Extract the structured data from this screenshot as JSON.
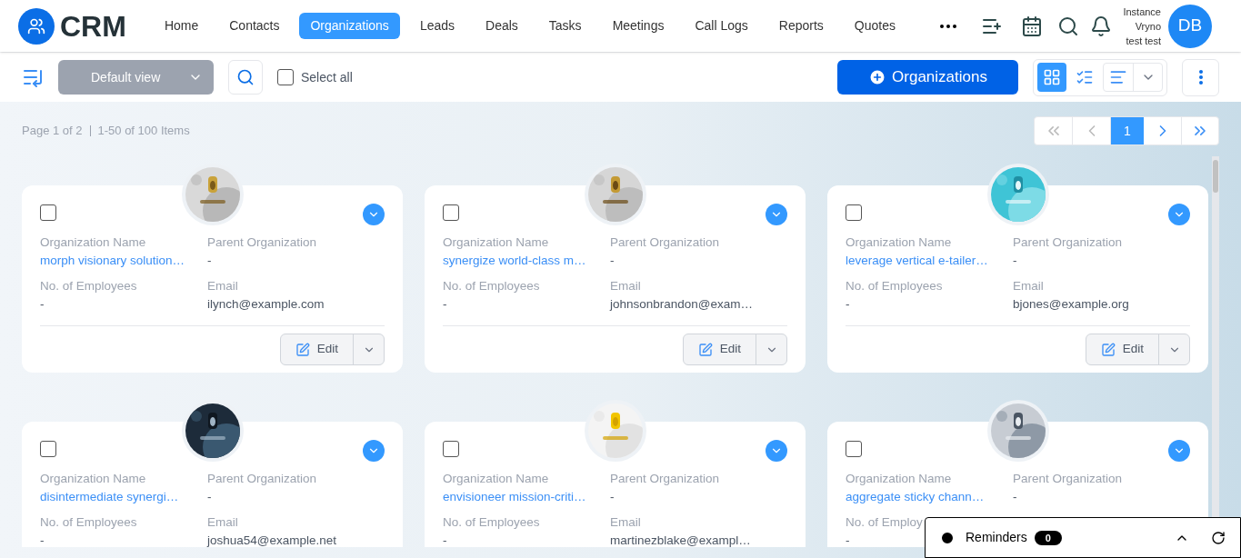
{
  "header": {
    "logo": "CRM",
    "nav": [
      {
        "label": "Home",
        "selected": false
      },
      {
        "label": "Contacts",
        "selected": false
      },
      {
        "label": "Organizations",
        "selected": true
      },
      {
        "label": "Leads",
        "selected": false
      },
      {
        "label": "Deals",
        "selected": false
      },
      {
        "label": "Tasks",
        "selected": false
      },
      {
        "label": "Meetings",
        "selected": false
      },
      {
        "label": "Call Logs",
        "selected": false
      },
      {
        "label": "Reports",
        "selected": false
      },
      {
        "label": "Quotes",
        "selected": false
      }
    ],
    "user": {
      "lines": [
        "Instance",
        "Vryno",
        "test test"
      ],
      "initials": "DB"
    }
  },
  "toolbar": {
    "view_select": "Default view",
    "select_all": {
      "label": "Select all",
      "checked": false
    },
    "new_button": "Organizations",
    "view_modes": [
      {
        "kind": "grid",
        "selected": true
      },
      {
        "kind": "list",
        "selected": false
      }
    ]
  },
  "pagination": {
    "page": "Page 1 of 2",
    "items": "1-50 of 100 Items",
    "current": "1"
  },
  "cards": [
    {
      "checked": false,
      "name_label": "Organization Name",
      "name": "morph visionary solution…",
      "parent_label": "Parent Organization",
      "parent": "-",
      "employees_label": "No. of Employees",
      "employees": "-",
      "email_label": "Email",
      "email": "ilynch@example.com",
      "action": "Edit"
    },
    {
      "checked": false,
      "name_label": "Organization Name",
      "name": "synergize world-class m…",
      "parent_label": "Parent Organization",
      "parent": "-",
      "employees_label": "No. of Employees",
      "employees": "-",
      "email_label": "Email",
      "email": "johnsonbrandon@exam…",
      "action": "Edit"
    },
    {
      "checked": false,
      "name_label": "Organization Name",
      "name": "leverage vertical e-tailer…",
      "parent_label": "Parent Organization",
      "parent": "-",
      "employees_label": "No. of Employees",
      "employees": "-",
      "email_label": "Email",
      "email": "bjones@example.org",
      "action": "Edit"
    },
    {
      "checked": false,
      "name_label": "Organization Name",
      "name": "disintermediate synergi…",
      "parent_label": "Parent Organization",
      "parent": "-",
      "employees_label": "No. of Employees",
      "employees": "-",
      "email_label": "Email",
      "email": "joshua54@example.net"
    },
    {
      "checked": false,
      "name_label": "Organization Name",
      "name": "envisioneer mission-criti…",
      "parent_label": "Parent Organization",
      "parent": "-",
      "employees_label": "No. of Employees",
      "employees": "-",
      "email_label": "Email",
      "email": "martinezblake@exampl…"
    },
    {
      "checked": false,
      "name_label": "Organization Name",
      "name": "aggregate sticky chann…",
      "parent_label": "Parent Organization",
      "parent": "-",
      "employees_label": "No. of Employ",
      "employees": "-"
    }
  ],
  "reminders": {
    "label": "Reminders",
    "count": "0"
  }
}
